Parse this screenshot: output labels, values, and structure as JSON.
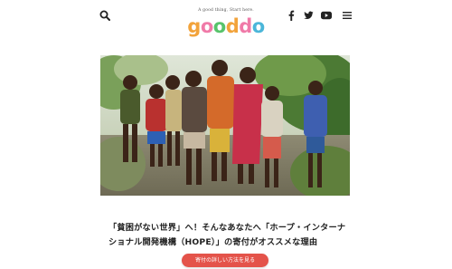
{
  "header": {
    "tagline": "A good thing, Start here.",
    "logo_letters": [
      {
        "char": "g",
        "color": "#f2a33b"
      },
      {
        "char": "o",
        "color": "#f07aa8"
      },
      {
        "char": "o",
        "color": "#58c36b"
      },
      {
        "char": "d",
        "color": "#f2a33b"
      },
      {
        "char": "d",
        "color": "#f07aa8"
      },
      {
        "char": "o",
        "color": "#4bb6d9"
      }
    ],
    "icons": [
      "search-icon",
      "facebook-icon",
      "twitter-icon",
      "youtube-icon",
      "menu-icon"
    ]
  },
  "article": {
    "title": "「貧困がない世界」へ！そんなあなたへ「ホープ・インターナショナル開発機構（HOPE）」の寄付がオススメな理由",
    "cta_label": "寄付の詳しい方法を見る",
    "cta_color": "#e4534a"
  }
}
